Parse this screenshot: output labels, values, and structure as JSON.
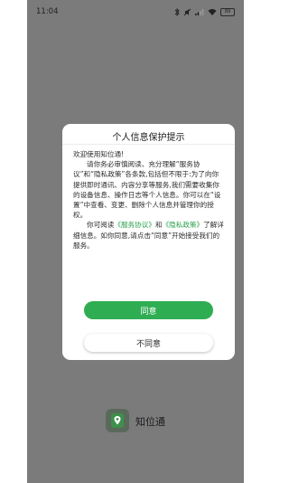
{
  "status_bar": {
    "time": "11:04",
    "battery": "89"
  },
  "dialog": {
    "title": "个人信息保护提示",
    "greeting": "欢迎使用知位通!",
    "para1": "请你务必审慎阅读、充分理解“服务协议”和“隐私政策”各条款,包括但不限于:为了向你提供即时通讯、内容分享等服务,我们需要收集你的设备信息、操作日志等个人信息。你可以在“设置”中查看、变更、删除个人信息并管理你的授权。",
    "para2_a": "你可阅读",
    "link_service": "《服务协议》",
    "para2_and": "和",
    "link_privacy": "《隐私政策》",
    "para2_b": "了解详细信息。如你同意,请点击“同意”开始接受我们的服务。",
    "agree_label": "同意",
    "disagree_label": "不同意"
  },
  "app": {
    "name": "知位通"
  },
  "colors": {
    "accent": "#2fad53",
    "overlay": "#7b7b7b"
  }
}
